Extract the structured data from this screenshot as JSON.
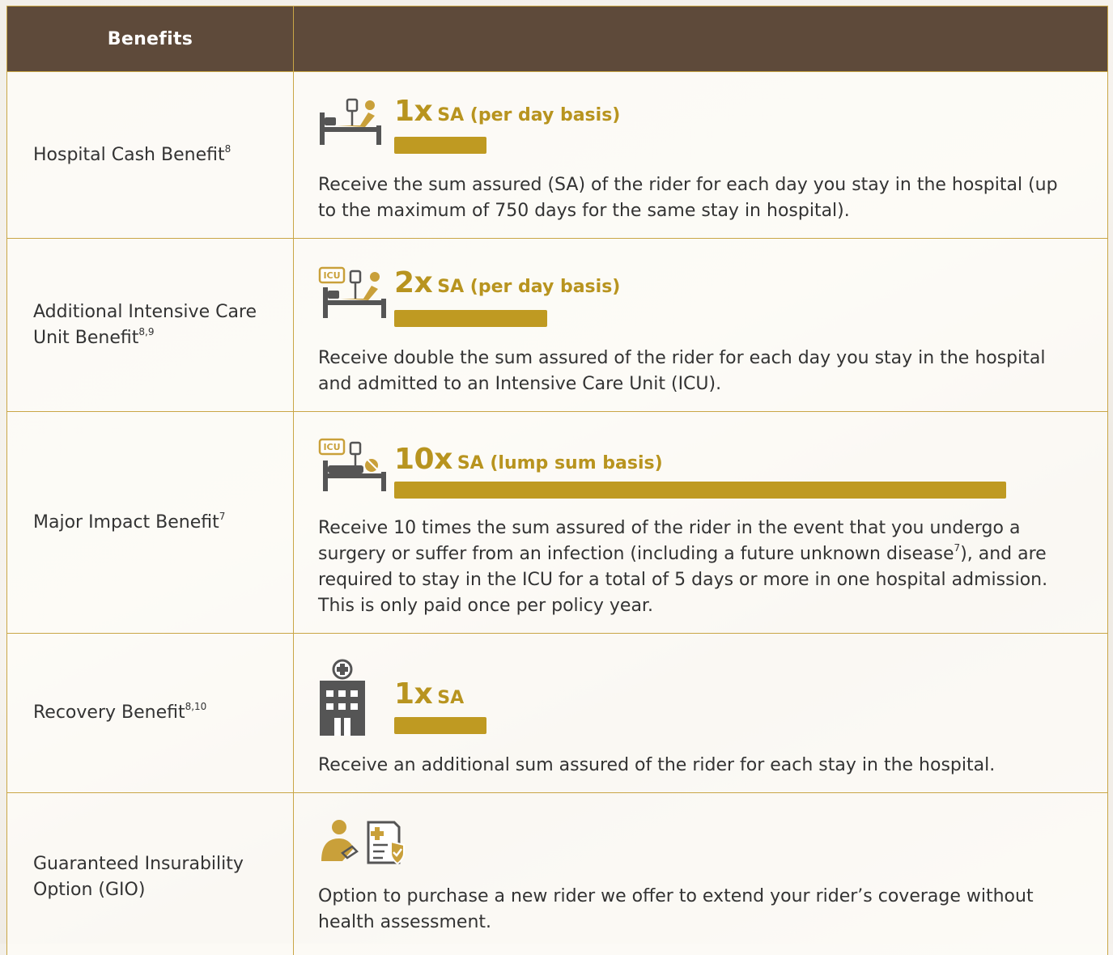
{
  "header": {
    "col1": "Benefits",
    "col2": ""
  },
  "rows": [
    {
      "label": "Hospital Cash Benefit",
      "label_sup": "8",
      "multiplier": "1x",
      "basis": "SA (per day basis)",
      "bar_fraction": 0.1,
      "desc": "Receive the sum assured (SA) of the rider for each day you stay in the hospital (up to the maximum of 750 days for the same stay in hospital)."
    },
    {
      "label": "Additional Intensive Care Unit Benefit",
      "label_sup": "8,9",
      "multiplier": "2x",
      "basis": "SA (per day basis)",
      "bar_fraction": 0.2,
      "icon_tag": "ICU",
      "desc": "Receive double the sum assured of the rider for each day you stay in the hospital and admitted to an Intensive Care Unit (ICU)."
    },
    {
      "label": "Major Impact Benefit",
      "label_sup": "7",
      "multiplier": "10x",
      "basis": "SA (lump sum basis)",
      "bar_fraction": 1.0,
      "icon_tag": "ICU",
      "desc_a": "Receive 10 times the sum assured of the rider in the event that you undergo a surgery or suffer from an infection (including a future unknown disease",
      "desc_sup": "7",
      "desc_b": "), and are required to stay in the ICU for a total of 5 days or more in one hospital admission. This is only paid once per policy year."
    },
    {
      "label": "Recovery Benefit",
      "label_sup": "8,10",
      "multiplier": "1x",
      "basis": "SA",
      "bar_fraction": 0.1,
      "desc": "Receive an additional sum assured of the rider for each stay in the hospital."
    },
    {
      "label": "Guaranteed Insurability Option (GIO)",
      "desc": "Option to purchase a new rider we offer to extend your rider’s coverage without health assessment."
    }
  ],
  "colors": {
    "header_bg": "#5e4a3a",
    "gold": "#bf9a22",
    "border": "#c9a646",
    "icon_gray": "#555555"
  },
  "icons": [
    "hospital-bed-icon",
    "icu-bed-icon",
    "icu-surgery-bed-icon",
    "hospital-building-icon",
    "doctor-icon",
    "insurance-document-shield-icon"
  ]
}
